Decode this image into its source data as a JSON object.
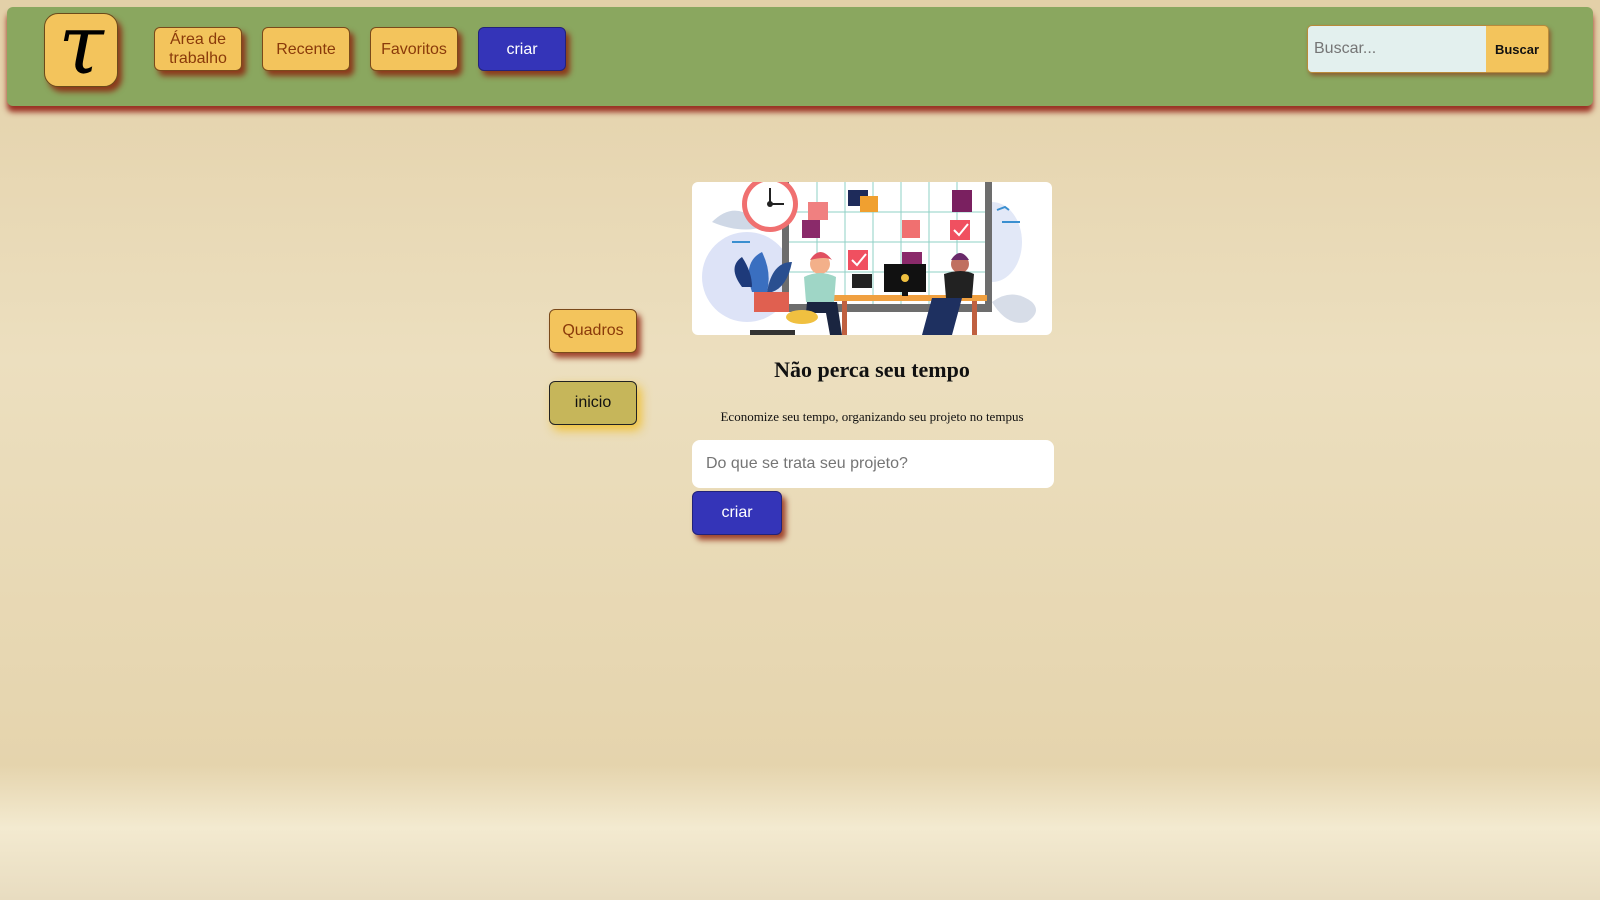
{
  "header": {
    "logo_glyph": "τ",
    "nav": [
      {
        "label_line1": "Área de",
        "label_line2": "trabalho"
      },
      {
        "label": "Recente"
      },
      {
        "label": "Favoritos"
      },
      {
        "label": "criar"
      }
    ],
    "search": {
      "placeholder": "Buscar...",
      "button_label": "Buscar"
    }
  },
  "sidebar": {
    "items": [
      {
        "label": "Quadros"
      },
      {
        "label": "inicio"
      }
    ]
  },
  "main": {
    "headline": "Não perca seu tempo",
    "subtext": "Economize seu tempo, organizando seu projeto no tempus",
    "project_input": {
      "placeholder": "Do que se trata seu projeto?"
    },
    "create_label": "criar"
  },
  "colors": {
    "topbar": "#8aa75f",
    "accent_yellow": "#f3c45c",
    "create_blue": "#3434b8",
    "inicio_olive": "#c6b65a"
  }
}
